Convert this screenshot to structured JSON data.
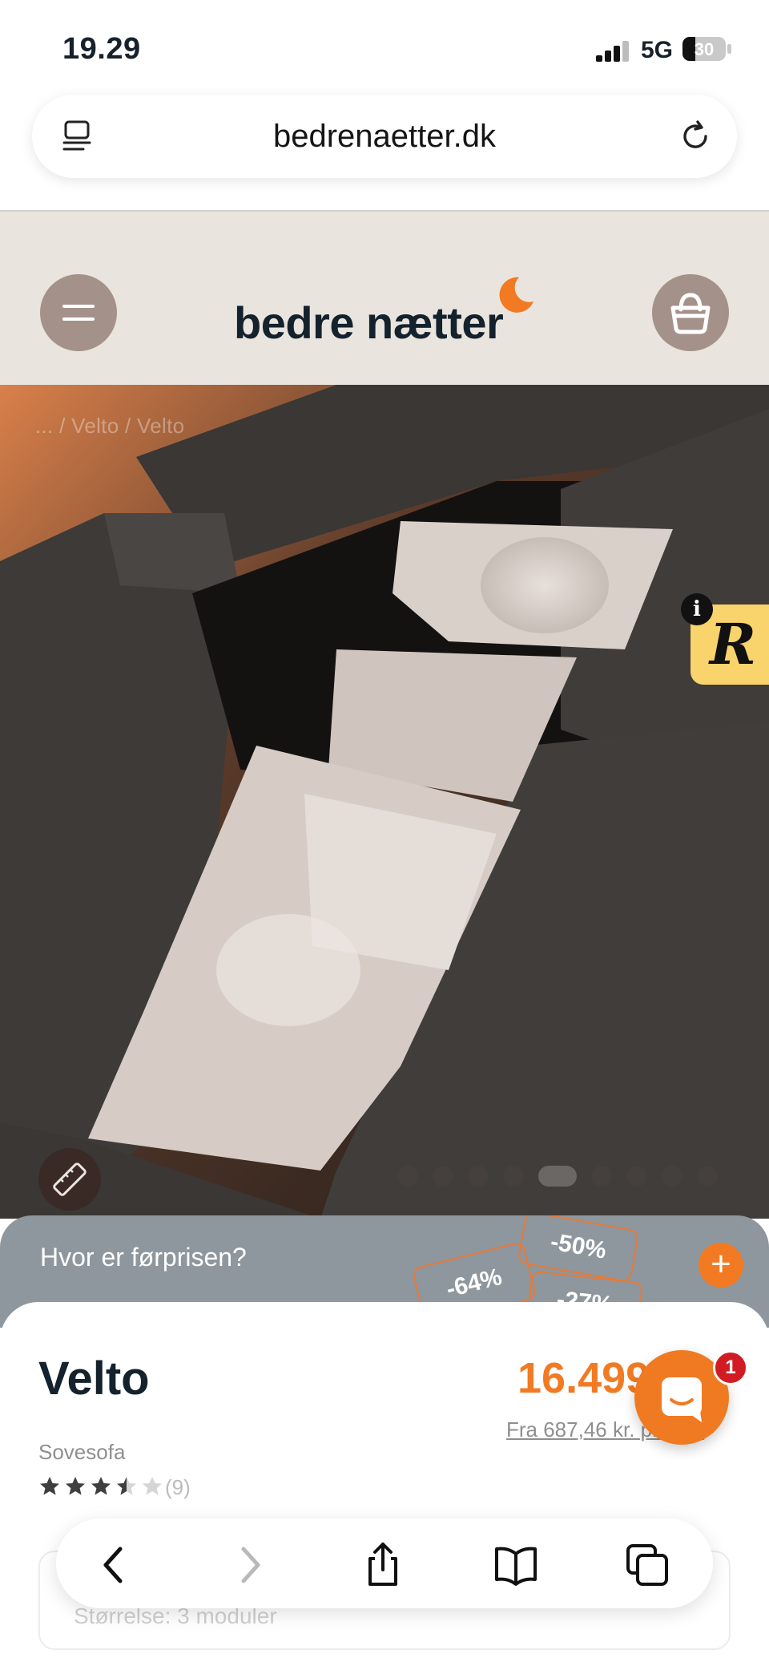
{
  "status_bar": {
    "time": "19.29",
    "network": "5G",
    "battery": "30",
    "battery_level": 0.3
  },
  "browser": {
    "url": "bedrenaetter.dk",
    "reader_icon": "reader-mode-icon",
    "reload_icon": "reload-icon"
  },
  "site_header": {
    "logo_text": "bedre nætter",
    "logo_icon": "moon-icon",
    "menu_icon": "hamburger-icon",
    "cart_icon": "basket-icon"
  },
  "hero": {
    "breadcrumb": "... / Velto / Velto",
    "measure_icon": "ruler-icon",
    "carousel": {
      "count": 9,
      "active_index": 4
    },
    "review_badge": {
      "info": "i",
      "letter": "R"
    }
  },
  "price_info": {
    "question": "Hvor er førprisen?",
    "tags": [
      "-64%",
      "-50%",
      "-27%"
    ],
    "plus": "+"
  },
  "product": {
    "title": "Velto",
    "price": "16.499",
    "monthly": "Fra 687,46 kr. pr. md.",
    "category": "Sovesofa",
    "rating": 3.5,
    "review_count": "(9)",
    "config": "Størrelse: 3 moduler"
  },
  "chat": {
    "badge": "1",
    "icon": "chat-icon"
  },
  "safari_toolbar": {
    "items": [
      "back-icon",
      "forward-icon",
      "share-icon",
      "bookmarks-icon",
      "tabs-icon"
    ]
  },
  "colors": {
    "accent": "#f27a22",
    "header_bg": "#e9e4dd",
    "button_bg": "#a4928a",
    "price_bar_bg": "#8e979d",
    "dark_text": "#14222e"
  }
}
